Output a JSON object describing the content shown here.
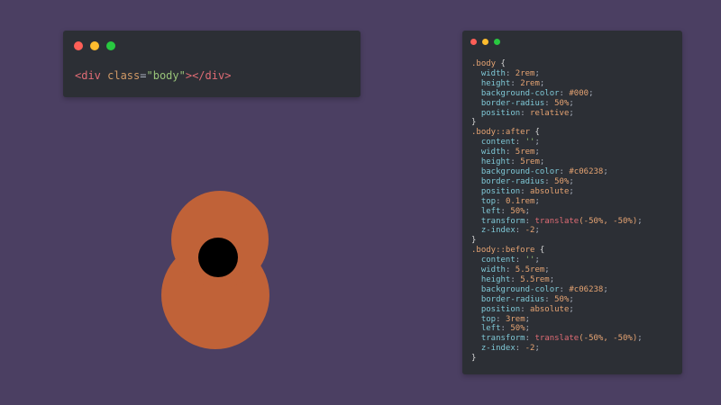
{
  "colors": {
    "background": "#4b3f62",
    "window": "#2c2f35",
    "dot_red": "#ff5f57",
    "dot_yellow": "#febc2e",
    "dot_green": "#28c840",
    "petal": "#c06238",
    "center": "#000000"
  },
  "html_editor": {
    "tokens": [
      {
        "text": "<div",
        "kind": "tag"
      },
      {
        "text": " class",
        "kind": "attr"
      },
      {
        "text": "=",
        "kind": "plain"
      },
      {
        "text": "\"body\"",
        "kind": "str"
      },
      {
        "text": "></div>",
        "kind": "tag"
      }
    ]
  },
  "css_editor": {
    "lines": [
      [
        {
          "text": ".body",
          "kind": "sel"
        },
        {
          "text": " {",
          "kind": "brace"
        }
      ],
      [
        {
          "text": "  width",
          "kind": "prop"
        },
        {
          "text": ": ",
          "kind": "plain"
        },
        {
          "text": "2rem",
          "kind": "val"
        },
        {
          "text": ";",
          "kind": "plain"
        }
      ],
      [
        {
          "text": "  height",
          "kind": "prop"
        },
        {
          "text": ": ",
          "kind": "plain"
        },
        {
          "text": "2rem",
          "kind": "val"
        },
        {
          "text": ";",
          "kind": "plain"
        }
      ],
      [
        {
          "text": "  background-color",
          "kind": "prop"
        },
        {
          "text": ": ",
          "kind": "plain"
        },
        {
          "text": "#000",
          "kind": "val"
        },
        {
          "text": ";",
          "kind": "plain"
        }
      ],
      [
        {
          "text": "  border-radius",
          "kind": "prop"
        },
        {
          "text": ": ",
          "kind": "plain"
        },
        {
          "text": "50%",
          "kind": "val"
        },
        {
          "text": ";",
          "kind": "plain"
        }
      ],
      [
        {
          "text": "  position",
          "kind": "prop"
        },
        {
          "text": ": ",
          "kind": "plain"
        },
        {
          "text": "relative",
          "kind": "val"
        },
        {
          "text": ";",
          "kind": "plain"
        }
      ],
      [
        {
          "text": "}",
          "kind": "brace"
        }
      ],
      [
        {
          "text": ".body::after",
          "kind": "sel"
        },
        {
          "text": " {",
          "kind": "brace"
        }
      ],
      [
        {
          "text": "  content",
          "kind": "prop"
        },
        {
          "text": ": ",
          "kind": "plain"
        },
        {
          "text": "''",
          "kind": "str"
        },
        {
          "text": ";",
          "kind": "plain"
        }
      ],
      [
        {
          "text": "  width",
          "kind": "prop"
        },
        {
          "text": ": ",
          "kind": "plain"
        },
        {
          "text": "5rem",
          "kind": "val"
        },
        {
          "text": ";",
          "kind": "plain"
        }
      ],
      [
        {
          "text": "  height",
          "kind": "prop"
        },
        {
          "text": ": ",
          "kind": "plain"
        },
        {
          "text": "5rem",
          "kind": "val"
        },
        {
          "text": ";",
          "kind": "plain"
        }
      ],
      [
        {
          "text": "  background-color",
          "kind": "prop"
        },
        {
          "text": ": ",
          "kind": "plain"
        },
        {
          "text": "#c06238",
          "kind": "val"
        },
        {
          "text": ";",
          "kind": "plain"
        }
      ],
      [
        {
          "text": "  border-radius",
          "kind": "prop"
        },
        {
          "text": ": ",
          "kind": "plain"
        },
        {
          "text": "50%",
          "kind": "val"
        },
        {
          "text": ";",
          "kind": "plain"
        }
      ],
      [
        {
          "text": "  position",
          "kind": "prop"
        },
        {
          "text": ": ",
          "kind": "plain"
        },
        {
          "text": "absolute",
          "kind": "val"
        },
        {
          "text": ";",
          "kind": "plain"
        }
      ],
      [
        {
          "text": "  top",
          "kind": "prop"
        },
        {
          "text": ": ",
          "kind": "plain"
        },
        {
          "text": "0.1rem",
          "kind": "val"
        },
        {
          "text": ";",
          "kind": "plain"
        }
      ],
      [
        {
          "text": "  left",
          "kind": "prop"
        },
        {
          "text": ": ",
          "kind": "plain"
        },
        {
          "text": "50%",
          "kind": "val"
        },
        {
          "text": ";",
          "kind": "plain"
        }
      ],
      [
        {
          "text": "  transform",
          "kind": "prop"
        },
        {
          "text": ": ",
          "kind": "plain"
        },
        {
          "text": "translate",
          "kind": "fn"
        },
        {
          "text": "(-50%, -50%)",
          "kind": "val"
        },
        {
          "text": ";",
          "kind": "plain"
        }
      ],
      [
        {
          "text": "  z-index",
          "kind": "prop"
        },
        {
          "text": ": ",
          "kind": "plain"
        },
        {
          "text": "-2",
          "kind": "val"
        },
        {
          "text": ";",
          "kind": "plain"
        }
      ],
      [
        {
          "text": "}",
          "kind": "brace"
        }
      ],
      [
        {
          "text": ".body::before",
          "kind": "sel"
        },
        {
          "text": " {",
          "kind": "brace"
        }
      ],
      [
        {
          "text": "  content",
          "kind": "prop"
        },
        {
          "text": ": ",
          "kind": "plain"
        },
        {
          "text": "''",
          "kind": "str"
        },
        {
          "text": ";",
          "kind": "plain"
        }
      ],
      [
        {
          "text": "  width",
          "kind": "prop"
        },
        {
          "text": ": ",
          "kind": "plain"
        },
        {
          "text": "5.5rem",
          "kind": "val"
        },
        {
          "text": ";",
          "kind": "plain"
        }
      ],
      [
        {
          "text": "  height",
          "kind": "prop"
        },
        {
          "text": ": ",
          "kind": "plain"
        },
        {
          "text": "5.5rem",
          "kind": "val"
        },
        {
          "text": ";",
          "kind": "plain"
        }
      ],
      [
        {
          "text": "  background-color",
          "kind": "prop"
        },
        {
          "text": ": ",
          "kind": "plain"
        },
        {
          "text": "#c06238",
          "kind": "val"
        },
        {
          "text": ";",
          "kind": "plain"
        }
      ],
      [
        {
          "text": "  border-radius",
          "kind": "prop"
        },
        {
          "text": ": ",
          "kind": "plain"
        },
        {
          "text": "50%",
          "kind": "val"
        },
        {
          "text": ";",
          "kind": "plain"
        }
      ],
      [
        {
          "text": "  position",
          "kind": "prop"
        },
        {
          "text": ": ",
          "kind": "plain"
        },
        {
          "text": "absolute",
          "kind": "val"
        },
        {
          "text": ";",
          "kind": "plain"
        }
      ],
      [
        {
          "text": "  top",
          "kind": "prop"
        },
        {
          "text": ": ",
          "kind": "plain"
        },
        {
          "text": "3rem",
          "kind": "val"
        },
        {
          "text": ";",
          "kind": "plain"
        }
      ],
      [
        {
          "text": "  left",
          "kind": "prop"
        },
        {
          "text": ": ",
          "kind": "plain"
        },
        {
          "text": "50%",
          "kind": "val"
        },
        {
          "text": ";",
          "kind": "plain"
        }
      ],
      [
        {
          "text": "  transform",
          "kind": "prop"
        },
        {
          "text": ": ",
          "kind": "plain"
        },
        {
          "text": "translate",
          "kind": "fn"
        },
        {
          "text": "(-50%, -50%)",
          "kind": "val"
        },
        {
          "text": ";",
          "kind": "plain"
        }
      ],
      [
        {
          "text": "  z-index",
          "kind": "prop"
        },
        {
          "text": ": ",
          "kind": "plain"
        },
        {
          "text": "-2",
          "kind": "val"
        },
        {
          "text": ";",
          "kind": "plain"
        }
      ],
      [
        {
          "text": "}",
          "kind": "brace"
        }
      ]
    ]
  }
}
